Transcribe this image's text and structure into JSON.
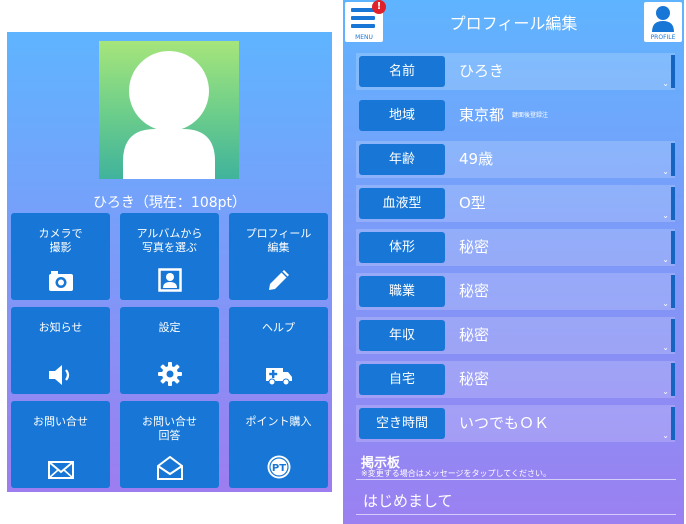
{
  "left_panel": {
    "user_status": "ひろき（現在：108pt）",
    "tiles": [
      {
        "label": "カメラで\n撮影",
        "icon": "camera-icon"
      },
      {
        "label": "アルバムから\n写真を選ぶ",
        "icon": "portrait-icon"
      },
      {
        "label": "プロフィール\n編集",
        "icon": "pencil-icon"
      },
      {
        "label": "お知らせ",
        "icon": "speaker-icon"
      },
      {
        "label": "設定",
        "icon": "gear-icon"
      },
      {
        "label": "ヘルプ",
        "icon": "ambulance-icon"
      },
      {
        "label": "お問い合せ",
        "icon": "envelope-icon"
      },
      {
        "label": "お問い合せ\n回答",
        "icon": "open-envelope-icon"
      },
      {
        "label": "ポイント購入",
        "icon": "pt-coin-icon"
      }
    ]
  },
  "right_panel": {
    "header": {
      "title": "プロフィール編集",
      "menu_label": "MENU",
      "profile_label": "PROFILE",
      "notification_badge": "!"
    },
    "fields": [
      {
        "label": "名前",
        "value": "ひろき",
        "note": "",
        "editable": true
      },
      {
        "label": "地域",
        "value": "東京都",
        "note": "鍵面後登録注",
        "editable": false
      },
      {
        "label": "年齢",
        "value": "49歳",
        "note": "",
        "editable": true
      },
      {
        "label": "血液型",
        "value": "O型",
        "note": "",
        "editable": true
      },
      {
        "label": "体形",
        "value": "秘密",
        "note": "",
        "editable": true
      },
      {
        "label": "職業",
        "value": "秘密",
        "note": "",
        "editable": true
      },
      {
        "label": "年収",
        "value": "秘密",
        "note": "",
        "editable": true
      },
      {
        "label": "自宅",
        "value": "秘密",
        "note": "",
        "editable": true
      },
      {
        "label": "空き時間",
        "value": "いつでもＯＫ",
        "note": "",
        "editable": true
      }
    ],
    "board": {
      "title": "掲示板",
      "note": "※変更する場合はメッセージをタップしてください。",
      "message": "はじめまして"
    }
  },
  "colors": {
    "tile_blue": "#1877d6",
    "accent_dark_blue": "#1565c0",
    "badge_red": "#e0202a"
  }
}
